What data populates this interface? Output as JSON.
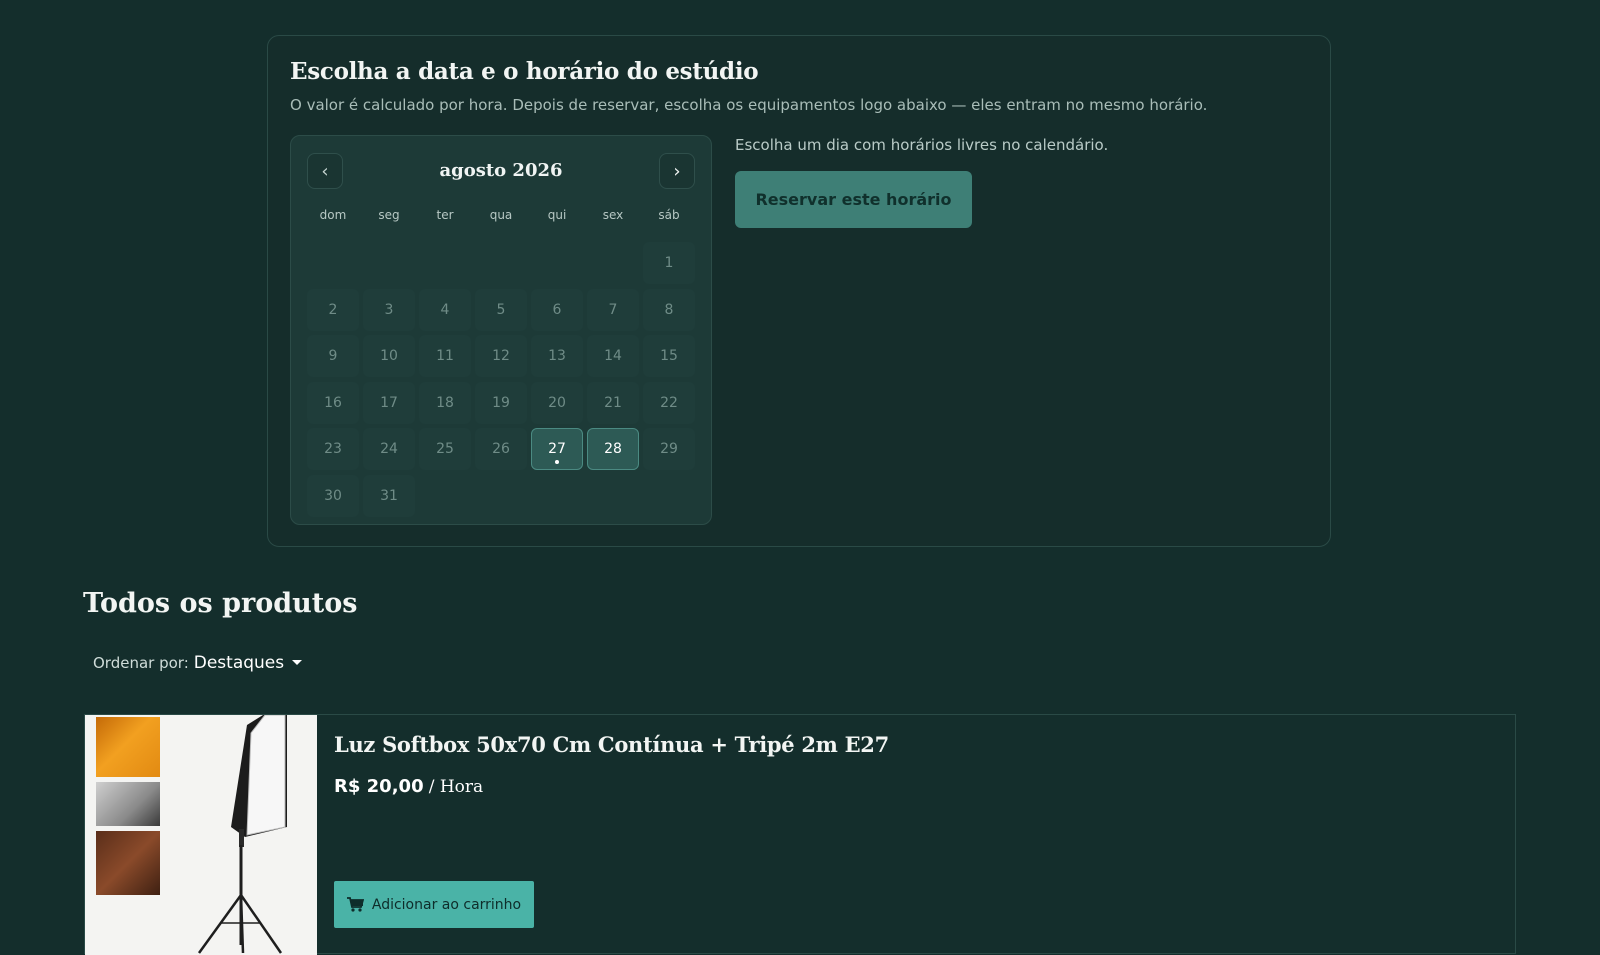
{
  "booking": {
    "title": "Escolha a data e o horário do estúdio",
    "subtitle": "O valor é calculado por hora. Depois de reservar, escolha os equipamentos logo abaixo — eles entram no mesmo horário.",
    "hint": "Escolha um dia com horários livres no calendário.",
    "reserve_label": "Reservar este horário",
    "calendar": {
      "month_label": "agosto 2026",
      "prev_label": "‹",
      "next_label": "›",
      "weekdays": [
        "dom",
        "seg",
        "ter",
        "qua",
        "qui",
        "sex",
        "sáb"
      ],
      "first_weekday_index": 6,
      "days_in_month": 31,
      "available_days": [
        27,
        28
      ],
      "marked_days": [
        27
      ]
    }
  },
  "products": {
    "title": "Todos os produtos",
    "sort_label": "Ordenar por:",
    "sort_value": "Destaques",
    "items": [
      {
        "name": "Luz Softbox 50x70 Cm Contínua + Tripé 2m E27",
        "price": "R$ 20,00",
        "unit": "/ Hora",
        "add_label": "Adicionar ao carrinho"
      }
    ]
  }
}
